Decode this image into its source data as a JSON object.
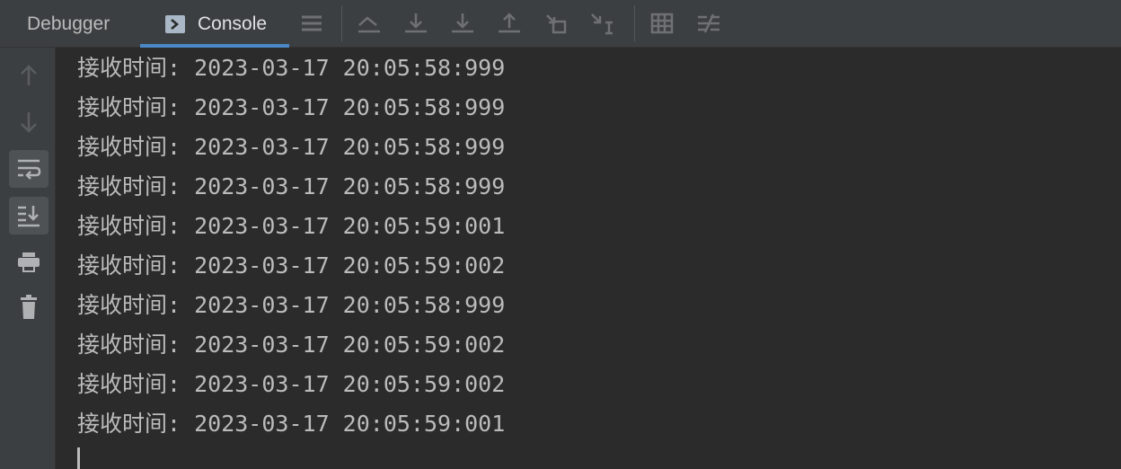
{
  "tabs": [
    {
      "label": "Debugger"
    },
    {
      "label": "Console"
    }
  ],
  "toolbar": {
    "icons": [
      "menu-icon",
      "show-execution-point-icon",
      "step-over-icon",
      "step-into-icon",
      "step-out-icon",
      "run-to-cursor-icon",
      "evaluate-icon",
      "table-icon",
      "settings-icon"
    ]
  },
  "sidebar": {
    "icons": [
      "up-arrow-icon",
      "down-arrow-icon",
      "soft-wrap-icon",
      "scroll-to-end-icon",
      "print-icon",
      "trash-icon"
    ]
  },
  "console": {
    "lines": [
      "接收时间: 2023-03-17 20:05:58:999",
      "接收时间: 2023-03-17 20:05:58:999",
      "接收时间: 2023-03-17 20:05:58:999",
      "接收时间: 2023-03-17 20:05:58:999",
      "接收时间: 2023-03-17 20:05:59:001",
      "接收时间: 2023-03-17 20:05:59:002",
      "接收时间: 2023-03-17 20:05:58:999",
      "接收时间: 2023-03-17 20:05:59:002",
      "接收时间: 2023-03-17 20:05:59:002",
      "接收时间: 2023-03-17 20:05:59:001"
    ]
  },
  "colors": {
    "background": "#2b2b2b",
    "panel": "#3c3f41",
    "text": "#bbbbbb",
    "accent": "#4a88c7"
  }
}
